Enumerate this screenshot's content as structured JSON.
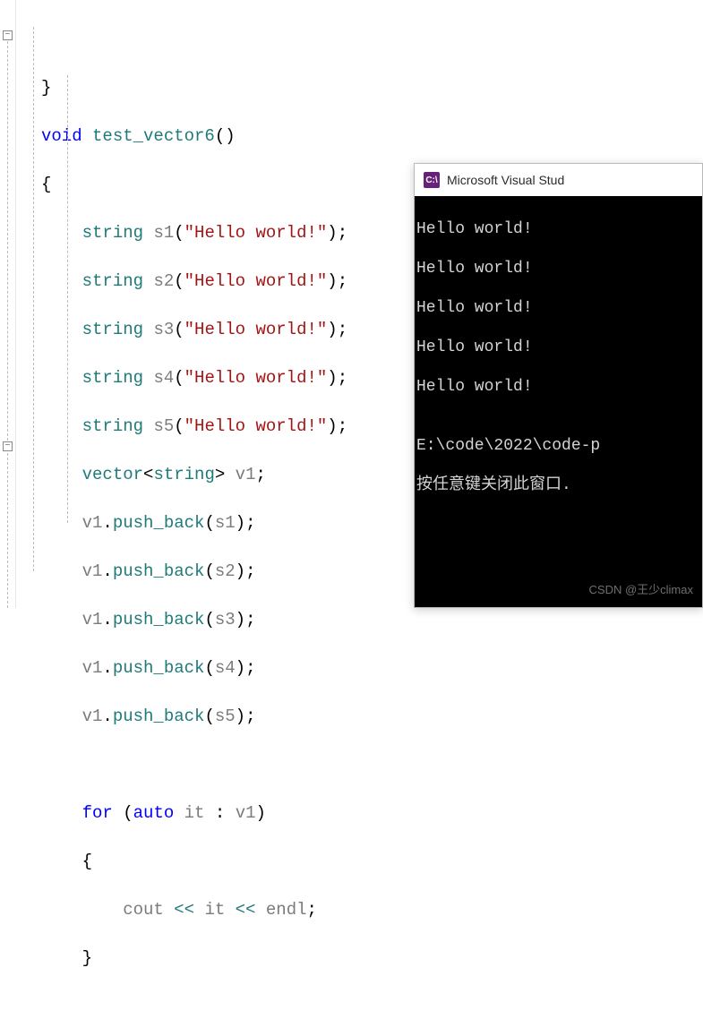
{
  "code": {
    "line1_brace": "}",
    "void": "void",
    "func": "test_vector6",
    "parens": "()",
    "open_brace": "{",
    "string_kw": "string",
    "s1": "s1",
    "s2": "s2",
    "s3": "s3",
    "s4": "s4",
    "s5": "s5",
    "hello": "\"Hello world!\"",
    "vector_decl_a": "vector",
    "vector_decl_b": "string",
    "v1": "v1",
    "push_back": "push_back",
    "for": "for",
    "auto": "auto",
    "it": "it",
    "colon": ":",
    "cout": "cout",
    "lshift": "<<",
    "endl": "endl",
    "close_brace_inner": "}",
    "semi": ";",
    "open": "(",
    "close": ")",
    "dot": ".",
    "lt": "<",
    "gt": ">",
    "inner_open_brace": "{",
    "inner_close_brace": "}"
  },
  "console": {
    "title": "Microsoft Visual Stud",
    "lines": [
      "Hello world!",
      "Hello world!",
      "Hello world!",
      "Hello world!",
      "Hello world!",
      "",
      "E:\\code\\2022\\code-p",
      "按任意键关闭此窗口."
    ]
  },
  "watermark": "CSDN @王少climax",
  "fold_icon": "−"
}
